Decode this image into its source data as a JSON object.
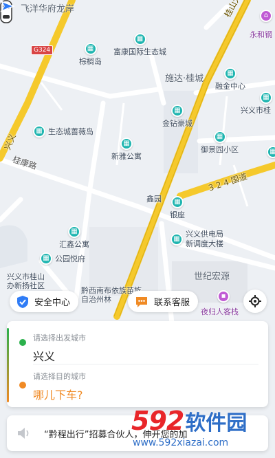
{
  "map": {
    "areas": [
      {
        "key": "feiyang",
        "label": "飞洋华府龙岸"
      },
      {
        "key": "shida",
        "label": "施达·桂城"
      }
    ],
    "roads": {
      "guishan": "桂山大道",
      "guikang": "桂康路",
      "guodao": "3 2 4 国道",
      "xingyi": "兴义",
      "g324": "G324"
    },
    "pois": [
      {
        "key": "yonghe",
        "name": "永和钢",
        "color": "purple"
      },
      {
        "key": "fukang",
        "name": "富康国际生态城"
      },
      {
        "key": "zongludao",
        "name": "棕榈岛"
      },
      {
        "key": "rongjin",
        "name": "融金中心"
      },
      {
        "key": "xingyishi",
        "name": "兴义市桂"
      },
      {
        "key": "jinzuan",
        "name": "金钻豪城"
      },
      {
        "key": "shengtai",
        "name": "生态城蔷薇岛"
      },
      {
        "key": "yujing",
        "name": "御景园小区"
      },
      {
        "key": "xinya",
        "name": "新雅公寓"
      },
      {
        "key": "yinzuo",
        "name": "银座"
      },
      {
        "key": "gongdian",
        "name": "兴义供电局\n新调度大楼"
      },
      {
        "key": "huixin",
        "name": "汇鑫公寓"
      },
      {
        "key": "gongyuan",
        "name": "公园悦府"
      },
      {
        "key": "shiji",
        "name": "世纪宏源"
      },
      {
        "key": "xingyishi2",
        "name": "兴义市桂山\n办新扬社区"
      },
      {
        "key": "qianxinan",
        "name": "黔西南布依族苗族\n自治州林"
      },
      {
        "key": "yeguiren",
        "name": "夜归人客栈",
        "color": "purple"
      },
      {
        "key": "xinyuan",
        "name": "鑫园"
      }
    ]
  },
  "chips": {
    "safety": "安全中心",
    "service": "联系客服"
  },
  "trip": {
    "from_hint": "请选择出发城市",
    "from_value": "兴义",
    "to_hint": "请选择目的城市",
    "to_value": "哪儿下车?"
  },
  "notice": {
    "text": "“黔程出行”招募合伙人，伸开您的加"
  },
  "watermark": {
    "num": "592",
    "cn": "软件园",
    "url": "www.592xiazai.com"
  },
  "colors": {
    "road_yellow": "#f5c92c",
    "poi_teal": "#1fb5b0",
    "poi_purple": "#c05bd4",
    "safety_blue": "#2f7cf6",
    "service_orange": "#f08a24",
    "from_green": "#2bb14c",
    "to_orange": "#f08a24",
    "watermark_red": "#e8262a",
    "watermark_blue": "#2e6ec7"
  }
}
